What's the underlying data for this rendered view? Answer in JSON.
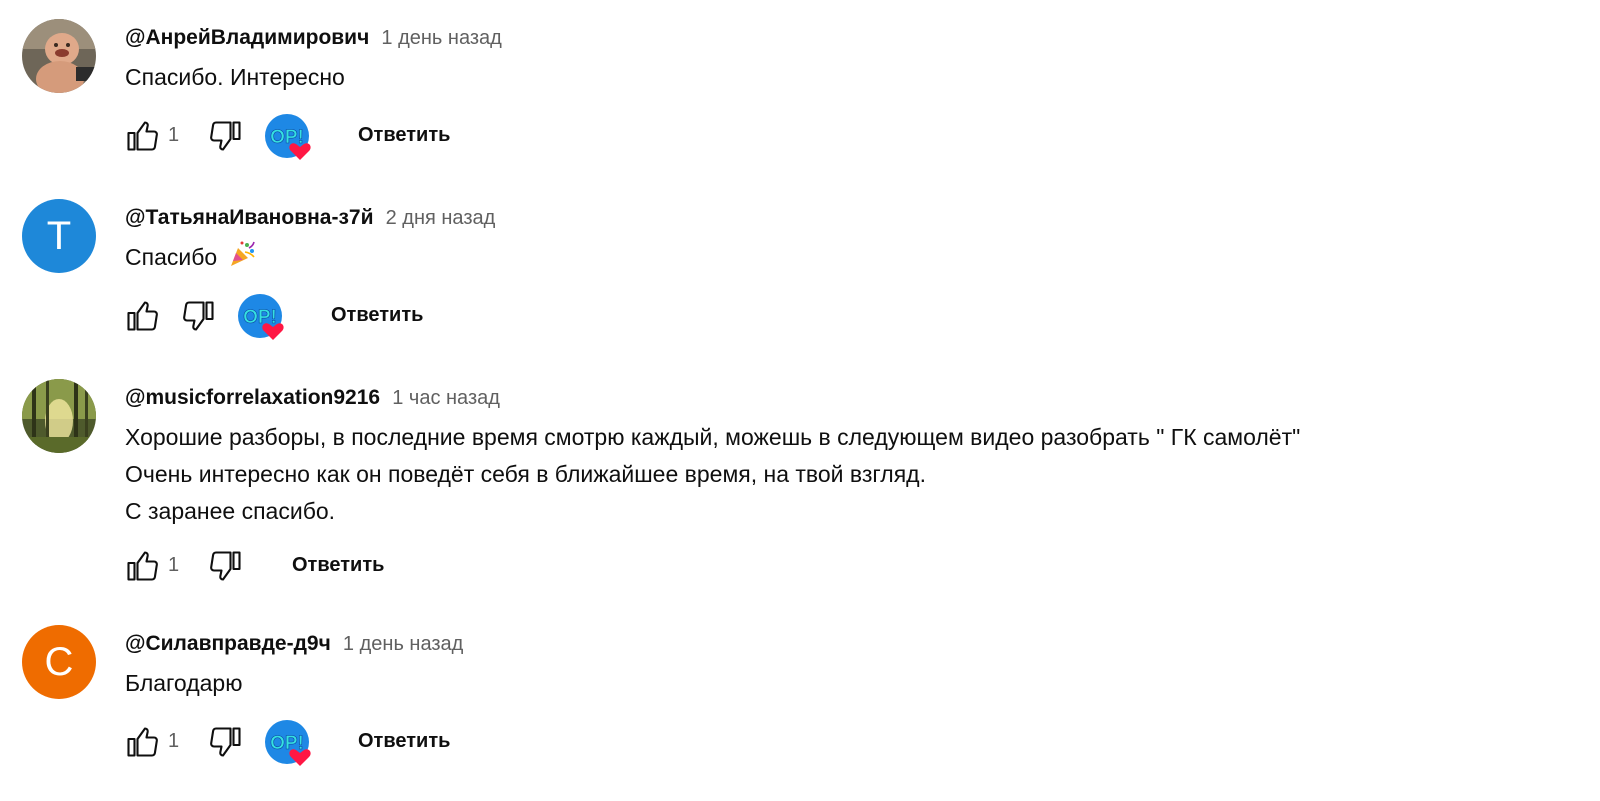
{
  "comments": [
    {
      "author": "@АнрейВладимирович",
      "time": "1 день назад",
      "lines": [
        "Спасибо. Интересно"
      ],
      "likes": "1",
      "reply": "Ответить",
      "avatar": {
        "type": "photo-baby",
        "bg": "#8a7a64"
      },
      "creator_heart": true
    },
    {
      "author": "@ТатьянаИвановна-з7й",
      "time": "2 дня назад",
      "lines": [
        "Спасибо"
      ],
      "emoji": "party-popper-icon",
      "likes": "",
      "reply": "Ответить",
      "avatar": {
        "type": "letter",
        "letter": "Т",
        "bg": "#1e88d9"
      },
      "creator_heart": true
    },
    {
      "author": "@musicforrelaxation9216",
      "time": "1 час назад",
      "lines": [
        "Хорошие разборы, в последние время смотрю каждый, можешь в следующем видео разобрать \" ГК самолёт\"",
        "Очень интересно как он поведёт себя в ближайшее время, на твой взгляд.",
        "С заранее спасибо."
      ],
      "likes": "1",
      "reply": "Ответить",
      "avatar": {
        "type": "photo-forest",
        "bg": "#6b7a3a"
      },
      "creator_heart": false
    },
    {
      "author": "@Силавправде-д9ч",
      "time": "1 день назад",
      "lines": [
        "Благодарю"
      ],
      "likes": "1",
      "reply": "Ответить",
      "avatar": {
        "type": "letter",
        "letter": "С",
        "bg": "#ef6c00"
      },
      "creator_heart": true
    }
  ],
  "colors": {
    "secondary_text": "#606060",
    "heart_red": "#ff1744",
    "badge_blue": "#1e88e5",
    "badge_cyan": "#35e0e0"
  }
}
